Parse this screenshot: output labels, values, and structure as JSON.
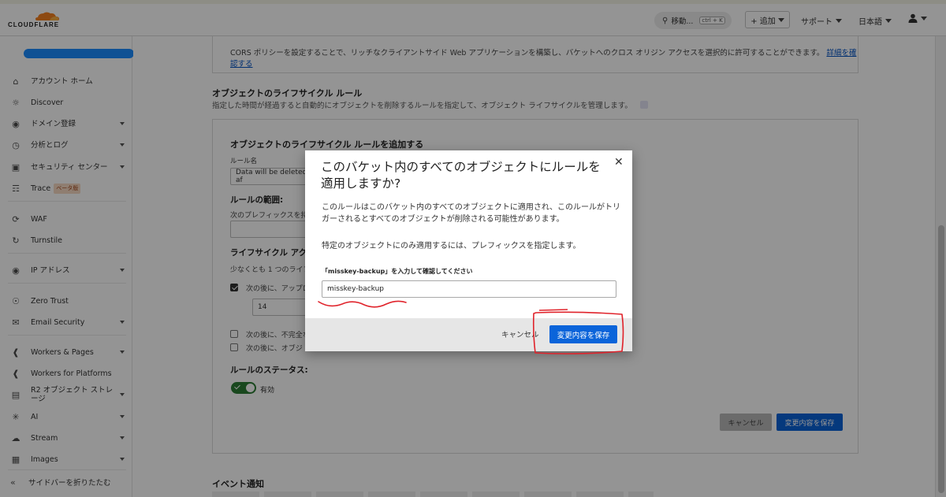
{
  "topbar": {
    "logo_text": "CLOUDFLARE",
    "search_label": "移動...",
    "search_shortcut": "ctrl + K",
    "add_label": "+ 追加",
    "support_label": "サポート",
    "language_label": "日本語"
  },
  "sidebar": {
    "items": [
      {
        "label": "アカウント ホーム",
        "icon": "home-icon"
      },
      {
        "label": "Discover",
        "icon": "lightbulb-icon"
      },
      {
        "label": "ドメイン登録",
        "icon": "globe-icon"
      },
      {
        "label": "分析とログ",
        "icon": "clock-icon"
      },
      {
        "label": "セキュリティ センター",
        "icon": "security-icon"
      },
      {
        "label": "Trace",
        "icon": "trace-icon",
        "badge": "ベータ版"
      },
      {
        "label": "WAF",
        "icon": "waf-icon"
      },
      {
        "label": "Turnstile",
        "icon": "turnstile-icon"
      },
      {
        "label": "IP アドレス",
        "icon": "location-icon"
      },
      {
        "label": "Zero Trust",
        "icon": "zero-trust-icon"
      },
      {
        "label": "Email Security",
        "icon": "email-icon"
      },
      {
        "label": "Workers & Pages",
        "icon": "workers-icon"
      },
      {
        "label": "Workers for Platforms",
        "icon": "workers-platforms-icon"
      },
      {
        "label": "R2 オブジェクト ストレージ",
        "icon": "database-icon"
      },
      {
        "label": "AI",
        "icon": "ai-icon"
      },
      {
        "label": "Stream",
        "icon": "cloud-icon"
      },
      {
        "label": "Images",
        "icon": "image-icon"
      }
    ],
    "collapse_label": "サイドバーを折りたたむ"
  },
  "main": {
    "cors_text": "CORS ポリシーを設定することで、リッチなクライアントサイド Web アプリケーションを構築し、バケットへのクロス オリジン アクセスを選択的に許可することができます。",
    "cors_link": "詳細を確認する",
    "lifecycle_title": "オブジェクトのライフサイクル ルール",
    "lifecycle_sub": "指定した時間が経過すると自動的にオブジェクトを削除するルールを指定して、オブジェクト ライフサイクルを管理します。",
    "card": {
      "title": "オブジェクトのライフサイクル ルールを追加する",
      "rule_name_label": "ルール名",
      "rule_name_value": "Data will be deleted af",
      "scope_title": "ルールの範囲:",
      "scope_desc": "次のプレフィックスを持つオ",
      "actions_title": "ライフサイクル アクシ",
      "actions_desc": "少なくとも 1 つのライフ",
      "opt1": "次の後に、アップロ",
      "opt1_days": "14",
      "opt2": "次の後に、不完全な",
      "opt3": "次の後に、オブジ",
      "status_title": "ルールのステータス:",
      "status_value": "有効",
      "cancel": "キャンセル",
      "save": "変更内容を保存"
    },
    "event_title": "イベント通知"
  },
  "modal": {
    "title": "このバケット内のすべてのオブジェクトにルールを適用しますか?",
    "p1": "このルールはこのバケット内のすべてのオブジェクトに適用され、このルールがトリガーされるとすべてのオブジェクトが削除される可能性があります。",
    "p2": "特定のオブジェクトにのみ適用するには、プレフィックスを指定します。",
    "confirm_label": "「misskey-backup」を入力して確認してください",
    "confirm_value": "misskey-backup",
    "cancel": "キャンセル",
    "save": "変更内容を保存"
  },
  "colors": {
    "accent": "#0b64da",
    "toggle_on": "#2c7c34",
    "annotation": "#e0232b"
  }
}
